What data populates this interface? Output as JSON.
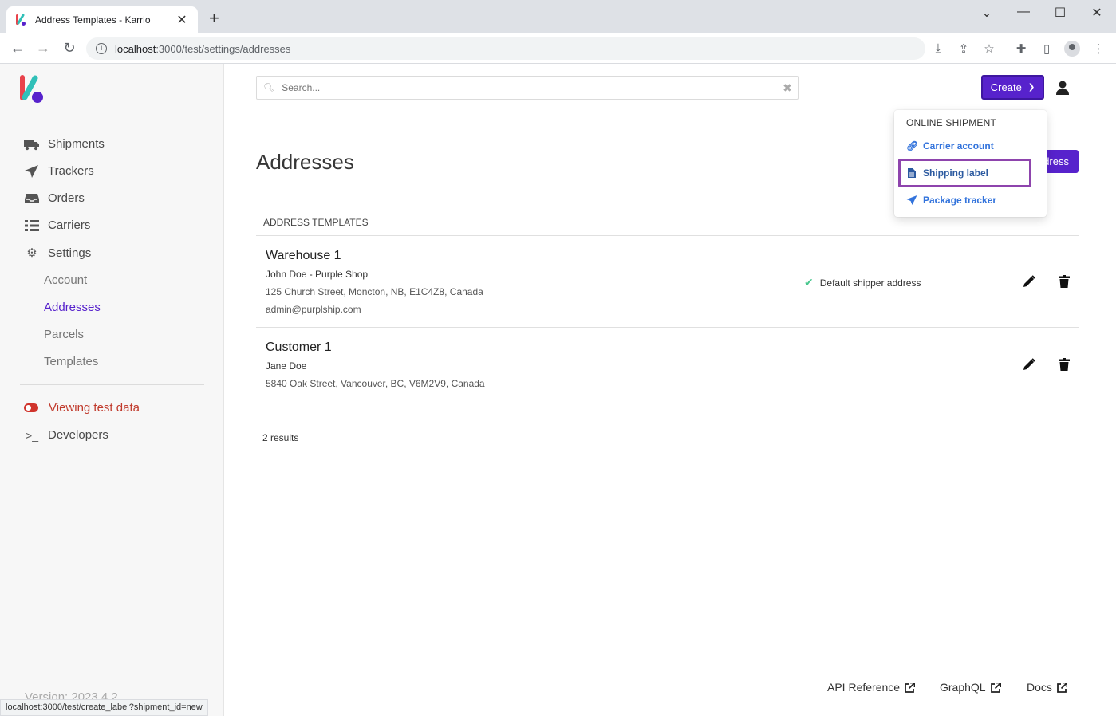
{
  "browser": {
    "tab_title": "Address Templates - Karrio",
    "url_host": "localhost",
    "url_path": ":3000/test/settings/addresses",
    "status_url": "localhost:3000/test/create_label?shipment_id=new"
  },
  "sidebar": {
    "items": [
      {
        "label": "Shipments",
        "icon": "truck-icon"
      },
      {
        "label": "Trackers",
        "icon": "paper-plane-icon"
      },
      {
        "label": "Orders",
        "icon": "inbox-icon"
      },
      {
        "label": "Carriers",
        "icon": "list-icon"
      },
      {
        "label": "Settings",
        "icon": "gear-icon"
      }
    ],
    "sub_items": [
      {
        "label": "Account"
      },
      {
        "label": "Addresses"
      },
      {
        "label": "Parcels"
      },
      {
        "label": "Templates"
      }
    ],
    "test_mode": "Viewing test data",
    "developers": "Developers",
    "version": "Version: 2023.4.2"
  },
  "header": {
    "search_placeholder": "Search...",
    "create_label": "Create"
  },
  "dropdown": {
    "heading": "ONLINE SHIPMENT",
    "items": [
      {
        "label": "Carrier account",
        "icon": "link-icon"
      },
      {
        "label": "Shipping label",
        "icon": "document-icon"
      },
      {
        "label": "Package tracker",
        "icon": "paper-plane-icon"
      }
    ]
  },
  "main": {
    "title": "Addresses",
    "add_button": "dress",
    "section_title": "ADDRESS TEMPLATES",
    "addresses": [
      {
        "name": "Warehouse 1",
        "contact": "John Doe - Purple Shop",
        "address": "125 Church Street, Moncton, NB, E1C4Z8, Canada",
        "email": "admin@purplship.com",
        "default_label": "Default shipper address"
      },
      {
        "name": "Customer 1",
        "contact": "Jane Doe",
        "address": "5840 Oak Street, Vancouver, BC, V6M2V9, Canada"
      }
    ],
    "results": "2 results"
  },
  "footer": {
    "links": [
      {
        "label": "API Reference"
      },
      {
        "label": "GraphQL"
      },
      {
        "label": "Docs"
      }
    ]
  },
  "colors": {
    "accent": "#5722cc",
    "link": "#3273dc",
    "test_mode": "#d0342c",
    "highlight": "#8e44ad"
  }
}
